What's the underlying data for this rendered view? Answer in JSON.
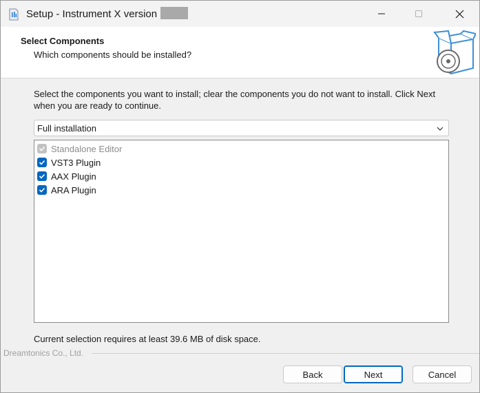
{
  "window": {
    "title": "Setup - Instrument X version",
    "icons": {
      "app": "installer-app-icon",
      "minimize": "minimize-icon",
      "maximize": "maximize-icon",
      "close": "close-icon"
    }
  },
  "header": {
    "title": "Select Components",
    "subtitle": "Which components should be installed?",
    "icon": "box-with-disc-icon"
  },
  "main": {
    "instructions": "Select the components you want to install; clear the components you do not want to install. Click Next when you are ready to continue.",
    "install_type": {
      "selected": "Full installation",
      "icon": "chevron-down-icon"
    },
    "components": [
      {
        "label": "Standalone Editor",
        "checked": true,
        "disabled": true
      },
      {
        "label": "VST3 Plugin",
        "checked": true,
        "disabled": false
      },
      {
        "label": "AAX Plugin",
        "checked": true,
        "disabled": false
      },
      {
        "label": "ARA Plugin",
        "checked": true,
        "disabled": false
      }
    ],
    "disk_space": "Current selection requires at least 39.6 MB of disk space."
  },
  "footer": {
    "company": "Dreamtonics Co., Ltd.",
    "back_label": "Back",
    "next_label": "Next",
    "cancel_label": "Cancel"
  },
  "colors": {
    "accent": "#0067c0",
    "disabled_check": "#c2c2c2",
    "window_bg": "#f0f0f0",
    "header_bg": "#ffffff"
  }
}
